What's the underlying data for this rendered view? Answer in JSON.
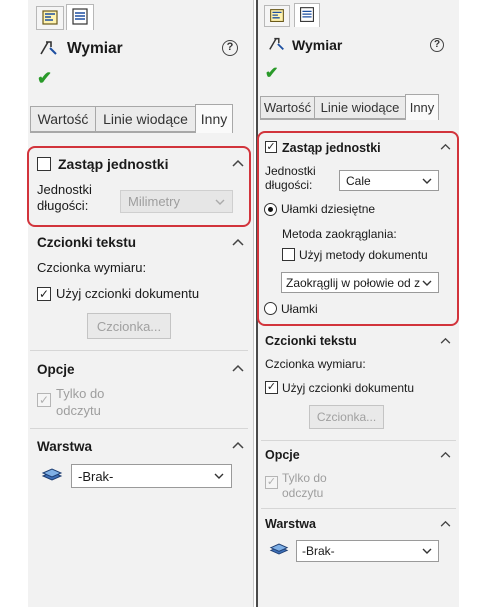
{
  "colors": {
    "panel_bg": "#f2f2f2",
    "highlight": "#d2343c",
    "ok_green": "#2a9a2a",
    "disabled_text": "#9e9e9e"
  },
  "left": {
    "title": "Wymiar",
    "help": "?",
    "tabs": [
      "Wartość",
      "Linie wiodące",
      "Inny"
    ],
    "units_section": {
      "override_label": "Zastąp jednostki",
      "length_label_line1": "Jednostki",
      "length_label_line2": "długości:",
      "length_value": "Milimetry"
    },
    "fonts_section": {
      "header": "Czcionki tekstu",
      "dimension_font_label": "Czcionka wymiaru:",
      "use_doc_font_label": "Użyj czcionki dokumentu",
      "font_button": "Czcionka..."
    },
    "options_section": {
      "header": "Opcje",
      "readonly_line1": "Tylko do",
      "readonly_line2": "odczytu"
    },
    "layer_section": {
      "header": "Warstwa",
      "value": "-Brak-"
    }
  },
  "right": {
    "title": "Wymiar",
    "help": "?",
    "tabs": [
      "Wartość",
      "Linie wiodące",
      "Inny"
    ],
    "units_section": {
      "override_label": "Zastąp jednostki",
      "length_label_line1": "Jednostki",
      "length_label_line2": "długości:",
      "length_value": "Cale",
      "decimal_label": "Ułamki dziesiętne",
      "rounding_label": "Metoda zaokrąglania:",
      "use_doc_method_label": "Użyj metody dokumentu",
      "rounding_value": "Zaokrąglij w połowie od z",
      "fractions_label": "Ułamki"
    },
    "fonts_section": {
      "header": "Czcionki tekstu",
      "dimension_font_label": "Czcionka wymiaru:",
      "use_doc_font_label": "Użyj czcionki dokumentu",
      "font_button": "Czcionka..."
    },
    "options_section": {
      "header": "Opcje",
      "readonly_line1": "Tylko do",
      "readonly_line2": "odczytu"
    },
    "layer_section": {
      "header": "Warstwa",
      "value": "-Brak-"
    }
  }
}
